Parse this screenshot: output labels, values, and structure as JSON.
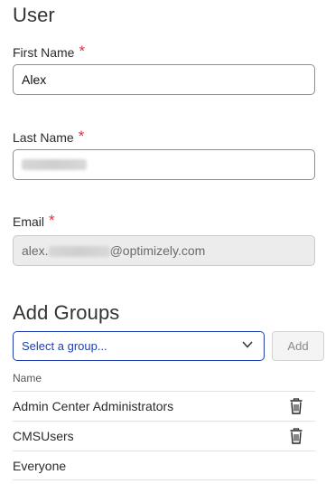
{
  "user": {
    "heading": "User",
    "first_name": {
      "label": "First Name",
      "required_mark": "*",
      "value": "Alex"
    },
    "last_name": {
      "label": "Last Name",
      "required_mark": "*"
    },
    "email": {
      "label": "Email",
      "required_mark": "*",
      "value_prefix": "alex.",
      "value_suffix": "@optimizely.com"
    }
  },
  "groups": {
    "heading": "Add Groups",
    "select_placeholder": "Select a group...",
    "add_label": "Add",
    "column_header": "Name",
    "items": [
      {
        "name": "Admin Center Administrators",
        "removable": true
      },
      {
        "name": "CMSUsers",
        "removable": true
      },
      {
        "name": "Everyone",
        "removable": false
      }
    ]
  }
}
